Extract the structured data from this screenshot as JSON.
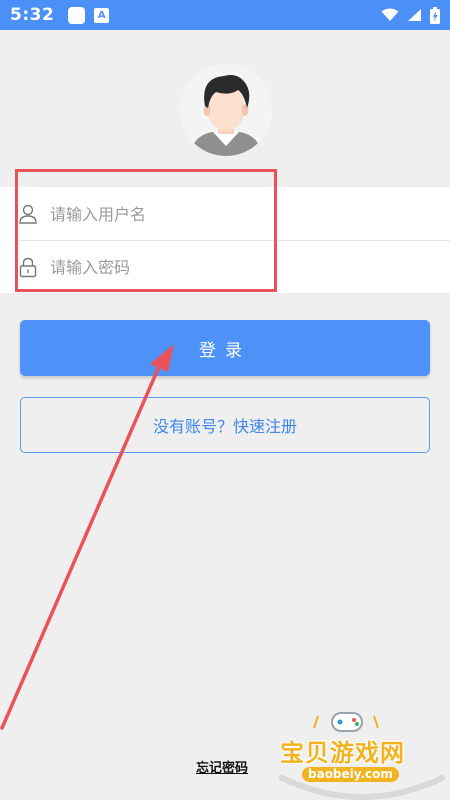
{
  "status_bar": {
    "time": "5:32",
    "notification_letter": "A"
  },
  "login_form": {
    "username_placeholder": "请输入用户名",
    "password_placeholder": "请输入密码",
    "login_label": "登录",
    "register_label": "没有账号？快速注册",
    "forgot_label": "忘记密码"
  },
  "watermark": {
    "title": "宝贝游戏网",
    "url": "baobeiy.com"
  },
  "colors": {
    "primary_blue": "#4f92f7",
    "annotation_red": "#e8535a",
    "watermark_gold": "#f2b320",
    "background": "#efefef"
  },
  "icons": {
    "username": "user-icon",
    "password": "lock-icon",
    "wifi": "wifi-icon",
    "signal": "signal-icon",
    "battery": "battery-icon"
  }
}
